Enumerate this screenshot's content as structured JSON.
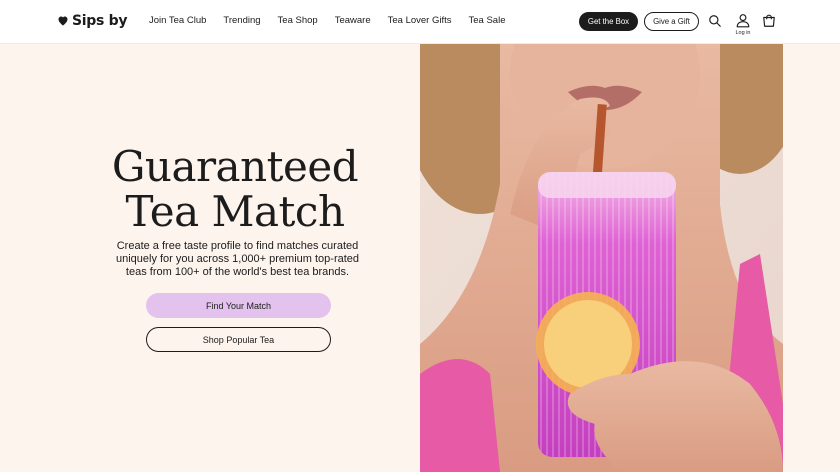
{
  "brand": {
    "name": "Sips by"
  },
  "nav": {
    "items": [
      {
        "label": "Join Tea Club"
      },
      {
        "label": "Trending"
      },
      {
        "label": "Tea Shop"
      },
      {
        "label": "Teaware"
      },
      {
        "label": "Tea Lover Gifts"
      },
      {
        "label": "Tea Sale"
      }
    ]
  },
  "header": {
    "get_box_label": "Get the Box",
    "give_gift_label": "Give a Gift",
    "login_label": "Log in",
    "icons": [
      "search-icon",
      "account-icon",
      "cart-icon"
    ]
  },
  "hero": {
    "title_line1": "Guaranteed",
    "title_line2": "Tea Match",
    "description": "Create a free taste profile to find matches curated uniquely for you across 1,000+ premium top-rated teas from 100+ of the world's best tea brands.",
    "primary_cta": "Find Your Match",
    "secondary_cta": "Shop Popular Tea"
  },
  "colors": {
    "hero_background": "#fdf4ee",
    "primary_cta_background": "#e4c2ee",
    "dark": "#1c1c1c",
    "drink_pink": "#d95ad8"
  }
}
